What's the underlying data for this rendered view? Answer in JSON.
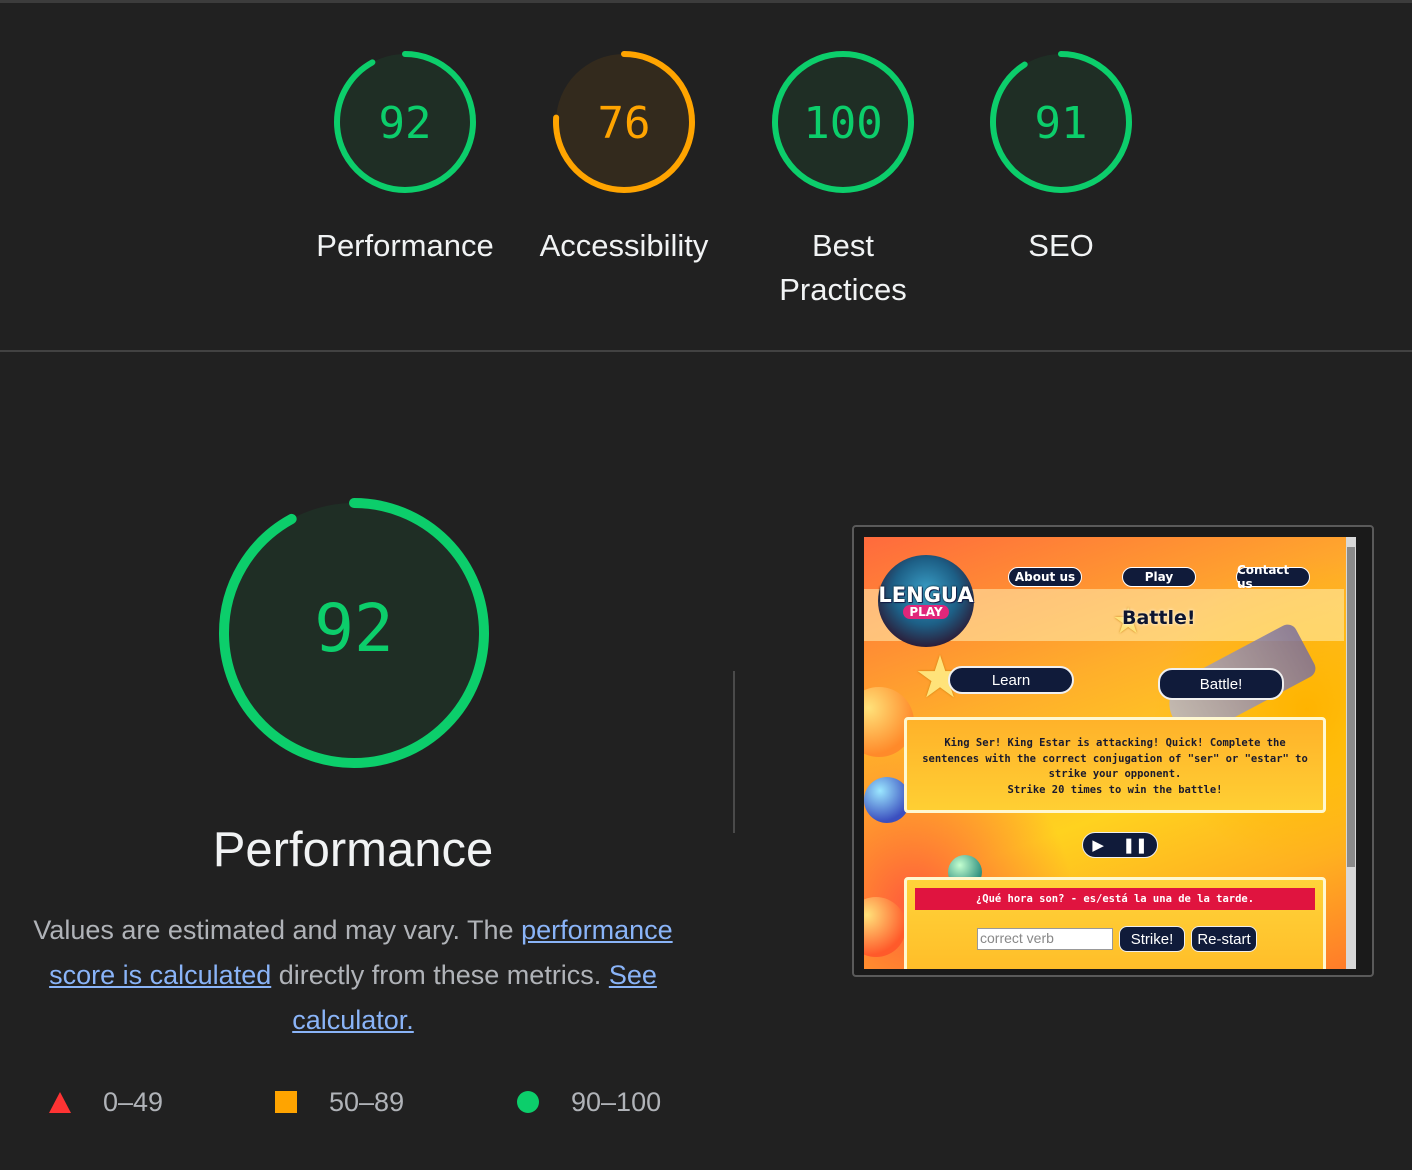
{
  "colors": {
    "pass": "#0cce6b",
    "average": "#ffa400",
    "fail": "#ff3333",
    "link": "#8ab4f8"
  },
  "categories": [
    {
      "score": 92,
      "label": "Performance",
      "rating": "pass"
    },
    {
      "score": 76,
      "label": "Accessibility",
      "rating": "average"
    },
    {
      "score": 100,
      "label": "Best Practices",
      "rating": "pass"
    },
    {
      "score": 91,
      "label": "SEO",
      "rating": "pass"
    }
  ],
  "main": {
    "score": 92,
    "title": "Performance",
    "desc_text_1": "Values are estimated and may vary. The ",
    "desc_link_1": "performance score is calculated",
    "desc_text_2": " directly from these metrics. ",
    "desc_link_2": "See calculator."
  },
  "legend": [
    {
      "shape": "triangle",
      "range": "0–49"
    },
    {
      "shape": "square",
      "range": "50–89"
    },
    {
      "shape": "circle",
      "range": "90–100"
    }
  ],
  "screenshot": {
    "logo_line1": "LENGUA",
    "logo_line2": "PLAY",
    "nav": [
      "About us",
      "Play",
      "Contact us"
    ],
    "heading": "Battle!",
    "mode_learn": "Learn",
    "mode_battle": "Battle!",
    "message": "King Ser! King Estar is attacking! Quick! Complete the sentences with the correct conjugation of \"ser\" or \"estar\" to strike your opponent.",
    "message_2": "Strike 20 times to win the battle!",
    "question": "¿Qué hora son? - es/está la una de la tarde.",
    "input_placeholder": "correct verb",
    "strike_button": "Strike!",
    "restart_button": "Re-start"
  }
}
